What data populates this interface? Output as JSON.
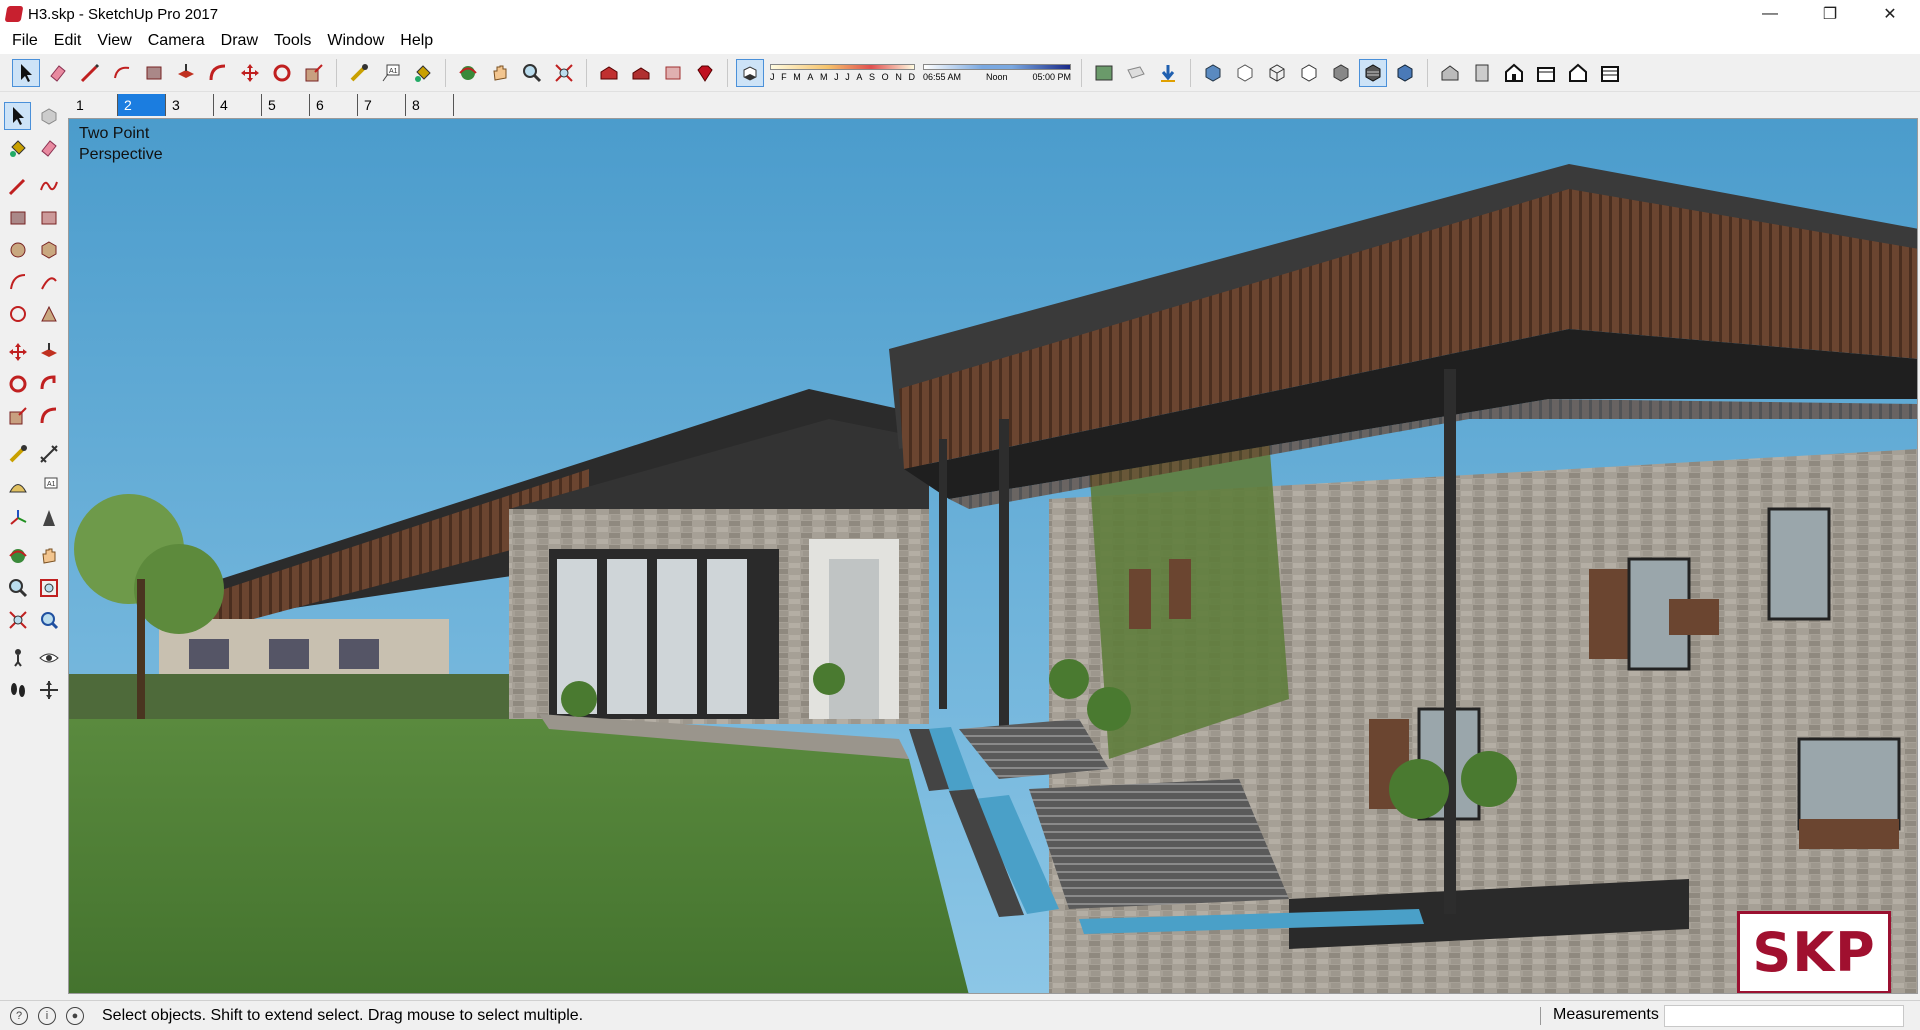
{
  "window": {
    "title": "H3.skp - SketchUp Pro 2017"
  },
  "menu": {
    "items": [
      "File",
      "Edit",
      "View",
      "Camera",
      "Draw",
      "Tools",
      "Window",
      "Help"
    ]
  },
  "shadows": {
    "months": [
      "J",
      "F",
      "M",
      "A",
      "M",
      "J",
      "J",
      "A",
      "S",
      "O",
      "N",
      "D"
    ],
    "time_start": "06:55 AM",
    "time_noon": "Noon",
    "time_end": "05:00 PM"
  },
  "scenes": {
    "tabs": [
      "1",
      "2",
      "3",
      "4",
      "5",
      "6",
      "7",
      "8"
    ],
    "active_index": 1
  },
  "viewport": {
    "camera_line1": "Two Point",
    "camera_line2": "Perspective",
    "watermark": "SKP"
  },
  "status": {
    "message": "Select objects. Shift to extend select. Drag mouse to select multiple.",
    "measurements_label": "Measurements",
    "measurements_value": ""
  },
  "colors": {
    "accent": "#1b7de0",
    "logo": "#a0102f",
    "sky": "#5fa9d4",
    "grass": "#4f7f36"
  }
}
